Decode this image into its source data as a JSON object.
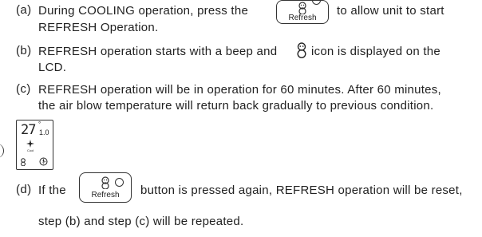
{
  "steps": [
    {
      "label": "(a)",
      "lines": [
        "During COOLING operation, press the",
        "to allow unit to start",
        "REFRESH Operation."
      ]
    },
    {
      "label": "(b)",
      "lines": [
        "REFRESH operation starts with a beep and",
        "icon is displayed on the",
        "LCD."
      ]
    },
    {
      "label": "(c)",
      "lines": [
        "REFRESH operation will be in operation for 60 minutes. After 60 minutes,",
        "the air blow temperature will return back gradually to previous condition."
      ]
    },
    {
      "label": "(d)",
      "lines": [
        "If the",
        "button is pressed again, REFRESH operation will be reset,",
        "step (b) and step (c) will be repeated."
      ]
    }
  ],
  "button": {
    "label": "Refresh",
    "icon": "snowman-refresh-icon"
  },
  "lcd": {
    "temperature": "27",
    "decimal": "1.0",
    "unit": "°",
    "fan_caption": "Cool"
  }
}
